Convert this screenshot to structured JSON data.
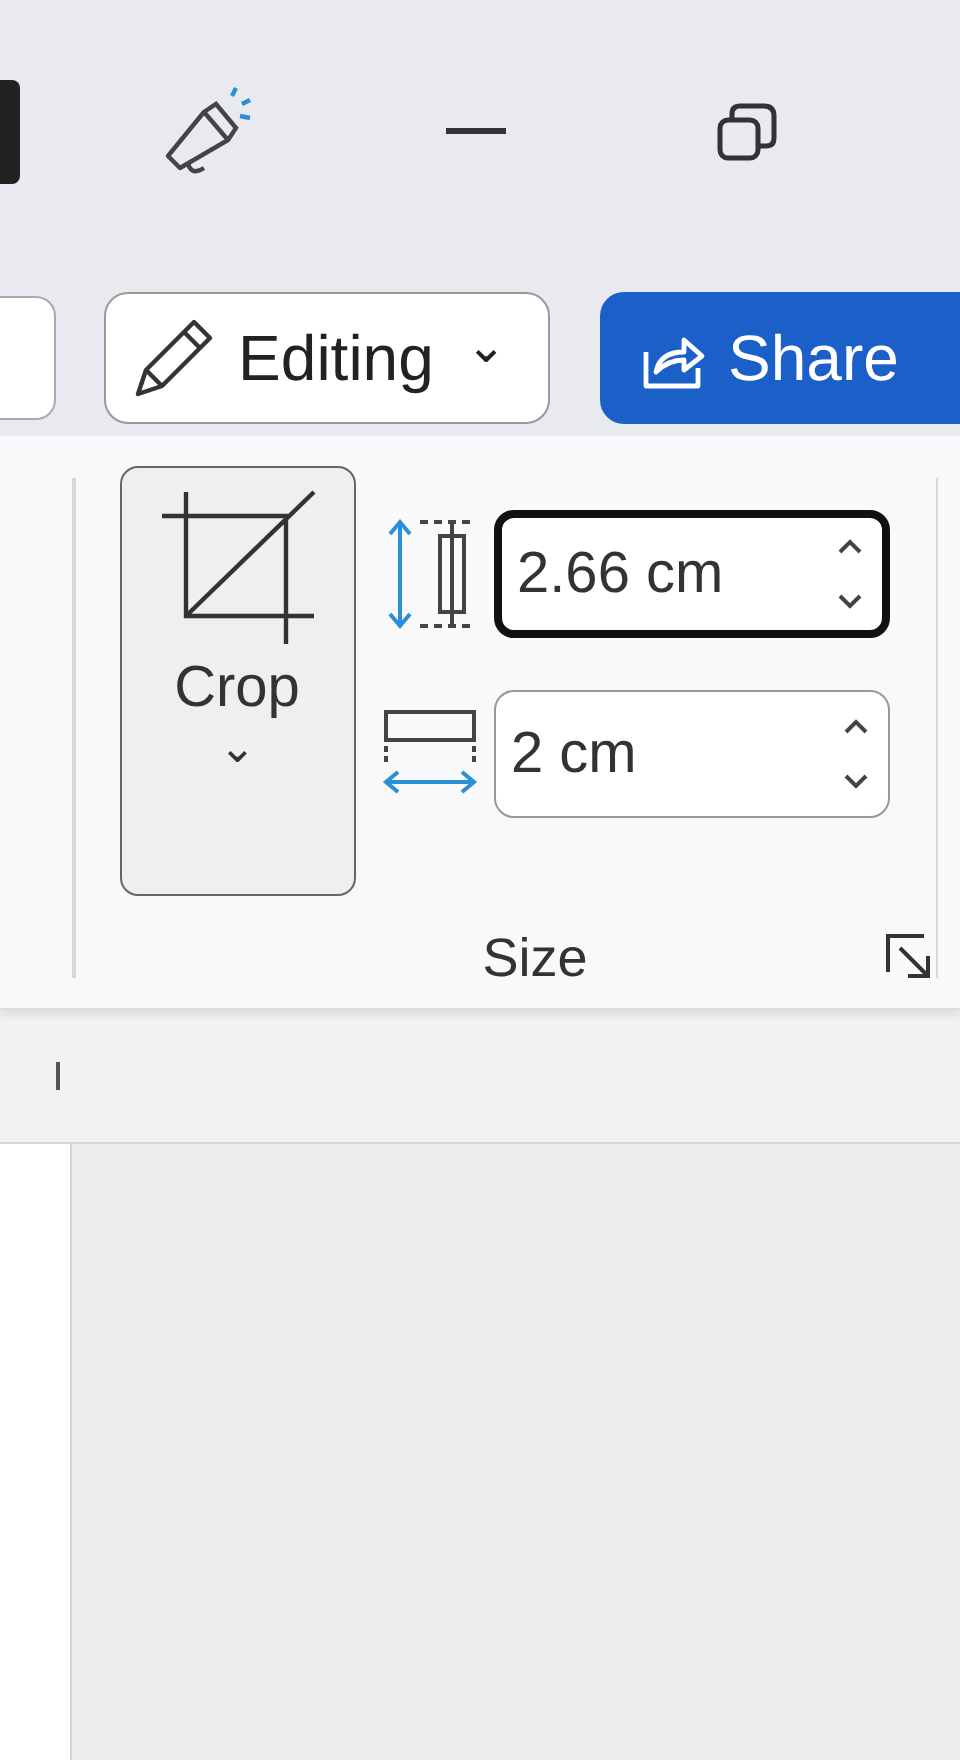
{
  "command_bar": {
    "editing_button": {
      "label": "Editing",
      "caret": "⌄"
    },
    "share_button": {
      "label": "Share"
    }
  },
  "ribbon": {
    "crop_button": {
      "label": "Crop",
      "caret": "⌄"
    },
    "fields": [
      {
        "kind": "height",
        "value": "2.66 cm",
        "focused": true
      },
      {
        "kind": "width",
        "value": "2 cm",
        "focused": false
      }
    ],
    "group_label": "Size"
  }
}
